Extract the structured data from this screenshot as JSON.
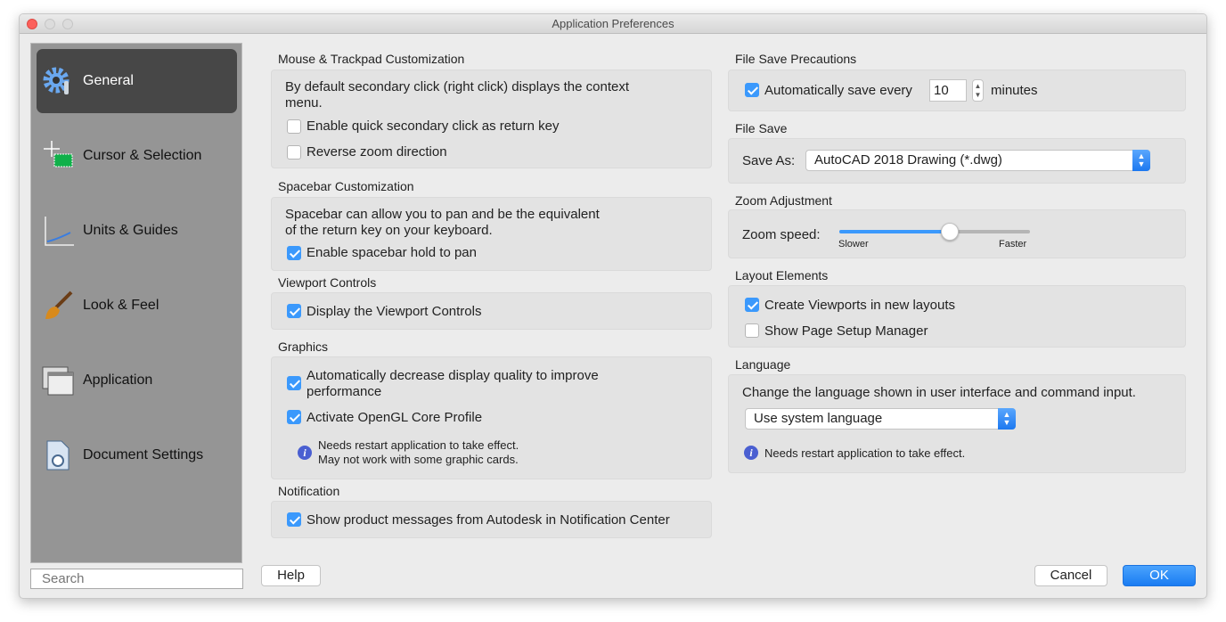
{
  "window": {
    "title": "Application Preferences"
  },
  "sidebar": {
    "items": [
      {
        "label": "General",
        "icon": "gear-wrench-icon",
        "selected": true
      },
      {
        "label": "Cursor & Selection",
        "icon": "cursor-selection-icon"
      },
      {
        "label": "Units & Guides",
        "icon": "units-guides-icon"
      },
      {
        "label": "Look & Feel",
        "icon": "paintbrush-icon"
      },
      {
        "label": "Application",
        "icon": "application-windows-icon"
      },
      {
        "label": "Document Settings",
        "icon": "document-settings-icon"
      }
    ],
    "search_placeholder": "Search"
  },
  "left": {
    "mouse": {
      "header": "Mouse & Trackpad Customization",
      "desc": "By default secondary click (right click) displays the context menu.",
      "options": [
        {
          "label": "Enable quick secondary click as return key",
          "checked": false
        },
        {
          "label": "Reverse zoom direction",
          "checked": false
        }
      ]
    },
    "spacebar": {
      "header": "Spacebar Customization",
      "desc": "Spacebar can allow you to pan and be the equivalent of the return key on your keyboard.",
      "option": {
        "label": "Enable spacebar hold to pan",
        "checked": true
      }
    },
    "viewport": {
      "header": "Viewport Controls",
      "option": {
        "label": "Display the Viewport Controls",
        "checked": true
      }
    },
    "graphics": {
      "header": "Graphics",
      "options": [
        {
          "label": "Automatically decrease display quality to improve performance",
          "checked": true
        },
        {
          "label": "Activate OpenGL Core Profile",
          "checked": true
        }
      ],
      "note1": "Needs restart application to take effect.",
      "note2": "May not work with some graphic cards."
    },
    "notification": {
      "header": "Notification",
      "option": {
        "label": "Show product messages from Autodesk in Notification Center",
        "checked": true
      }
    }
  },
  "right": {
    "precautions": {
      "header": "File Save Precautions",
      "label": "Automatically save every",
      "checked": true,
      "value": "10",
      "unit": "minutes"
    },
    "filesave": {
      "header": "File Save",
      "label": "Save As:",
      "value": "AutoCAD 2018 Drawing (*.dwg)"
    },
    "zoom": {
      "header": "Zoom Adjustment",
      "label": "Zoom speed:",
      "min_label": "Slower",
      "max_label": "Faster",
      "value_fraction": 0.58
    },
    "layout": {
      "header": "Layout Elements",
      "options": [
        {
          "label": "Create Viewports in new layouts",
          "checked": true
        },
        {
          "label": "Show Page Setup Manager",
          "checked": false
        }
      ]
    },
    "language": {
      "header": "Language",
      "desc": "Change the language shown in user interface and command input.",
      "value": "Use system language",
      "note": "Needs restart application to take effect."
    }
  },
  "footer": {
    "help": "Help",
    "cancel": "Cancel",
    "ok": "OK"
  },
  "colors": {
    "accent": "#3b99fc",
    "sidebar_selected": "#474747",
    "sidebar": "#959595"
  }
}
